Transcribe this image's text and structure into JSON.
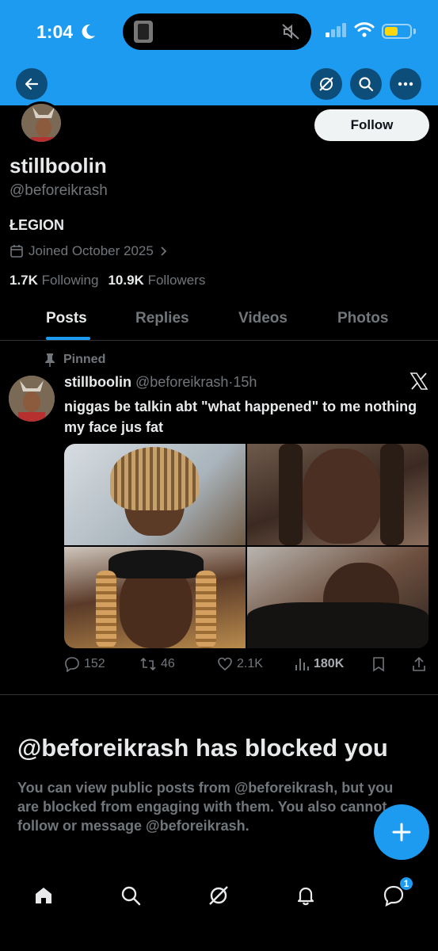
{
  "status_bar": {
    "time": "1:04"
  },
  "header": {
    "back_icon": "arrow-left-icon",
    "grok_icon": "grok-icon",
    "search_icon": "search-icon",
    "more_icon": "more-icon"
  },
  "profile": {
    "follow_label": "Follow",
    "display_name": "stillboolin",
    "handle": "@beforeikrash",
    "bio": "ŁEGION",
    "joined": "Joined October 2025",
    "following_count": "1.7K",
    "following_label": "Following",
    "followers_count": "10.9K",
    "followers_label": "Followers"
  },
  "tabs": [
    {
      "label": "Posts",
      "active": true
    },
    {
      "label": "Replies",
      "active": false
    },
    {
      "label": "Videos",
      "active": false
    },
    {
      "label": "Photos",
      "active": false
    }
  ],
  "post": {
    "pinned_label": "Pinned",
    "author_name": "stillboolin",
    "author_handle": "@beforeikrash",
    "separator": "·",
    "time_ago": "15h",
    "text": "niggas be talkin abt \"what happened\" to me nothing my face jus fat",
    "photo_count": 4,
    "replies": "152",
    "reposts": "46",
    "likes": "2.1K",
    "views": "180K"
  },
  "blocked": {
    "title": "@beforeikrash has blocked you",
    "body": "You can view public posts from @beforeikrash, but you are blocked from engaging with them. You also cannot follow or message @beforeikrash."
  },
  "bottom_nav": {
    "items": [
      "home-icon",
      "search-icon",
      "grok-icon",
      "notifications-icon",
      "messages-icon"
    ],
    "messages_badge": "1"
  },
  "colors": {
    "accent": "#1d9bf0",
    "background": "#000000",
    "text_primary": "#e7e9ea",
    "text_secondary": "#71767b"
  }
}
